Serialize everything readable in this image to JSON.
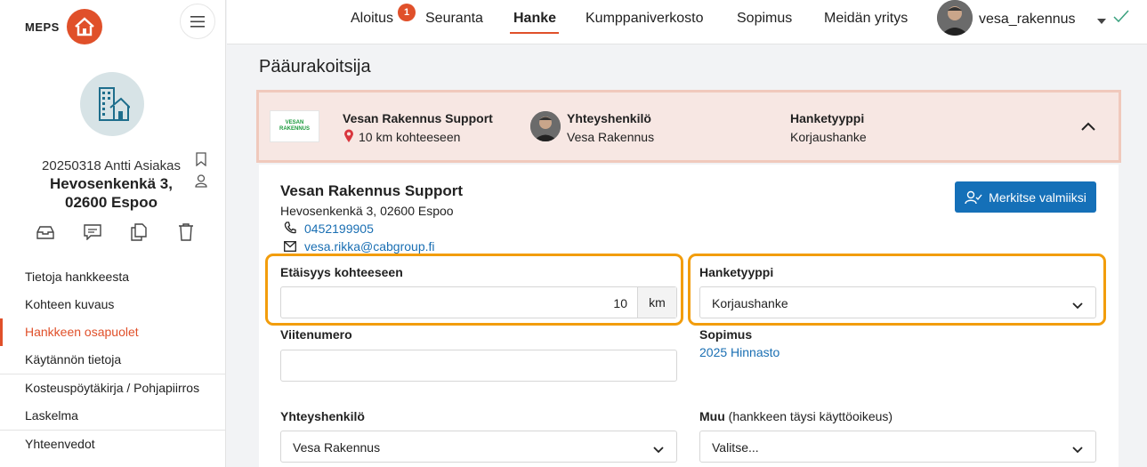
{
  "brand": {
    "logo_text": "MEPS",
    "accent": "#e0502a",
    "link": "#1a6fb3",
    "primary": "#1570b8",
    "highlight": "#f29d0c"
  },
  "project": {
    "id": "20250318 Antti Asiakas",
    "address_line1": "Hevosenkenkä 3,",
    "address_line2": "02600 Espoo"
  },
  "sidebar": {
    "nav": [
      {
        "label": "Tietoja hankkeesta"
      },
      {
        "label": "Kohteen kuvaus"
      },
      {
        "label": "Hankkeen osapuolet"
      },
      {
        "label": "Käytännön tietoja"
      },
      {
        "label": "Kosteuspöytäkirja / Pohjapiirros"
      },
      {
        "label": "Laskelma"
      },
      {
        "label": "Yhteenvedot"
      }
    ],
    "active_index": 2
  },
  "topnav": {
    "tabs": [
      {
        "label": "Aloitus"
      },
      {
        "label": "Seuranta"
      },
      {
        "label": "Hanke"
      },
      {
        "label": "Kumppaniverkosto"
      },
      {
        "label": "Sopimus"
      },
      {
        "label": "Meidän yritys"
      }
    ],
    "active": "Hanke",
    "badge": "1",
    "username": "vesa_rakennus"
  },
  "page_title": "Pääurakoitsija",
  "partner": {
    "logo_text": "VESAN RAKENNUS",
    "name": "Vesan Rakennus Support",
    "distance": "10 km kohteeseen",
    "contact_label": "Yhteyshenkilö",
    "contact_name": "Vesa Rakennus",
    "type_label": "Hanketyyppi",
    "type_value": "Korjaushanke"
  },
  "detail": {
    "name": "Vesan Rakennus Support",
    "address": "Hevosenkenkä 3, 02600 Espoo",
    "phone": "0452199905",
    "email": "vesa.rikka@cabgroup.fi",
    "done_button": "Merkitse valmiiksi"
  },
  "form": {
    "distance_label": "Etäisyys kohteeseen",
    "distance_value": "10",
    "distance_unit": "km",
    "project_type_label": "Hanketyyppi",
    "project_type_value": "Korjaushanke",
    "reference_label": "Viitenumero",
    "reference_value": "",
    "contract_label": "Sopimus",
    "contract_value": "2025 Hinnasto",
    "contact_label": "Yhteyshenkilö",
    "contact_value": "Vesa Rakennus",
    "other_label": "Muu",
    "other_note": "(hankkeen täysi käyttöoikeus)",
    "other_value": "Valitse..."
  }
}
